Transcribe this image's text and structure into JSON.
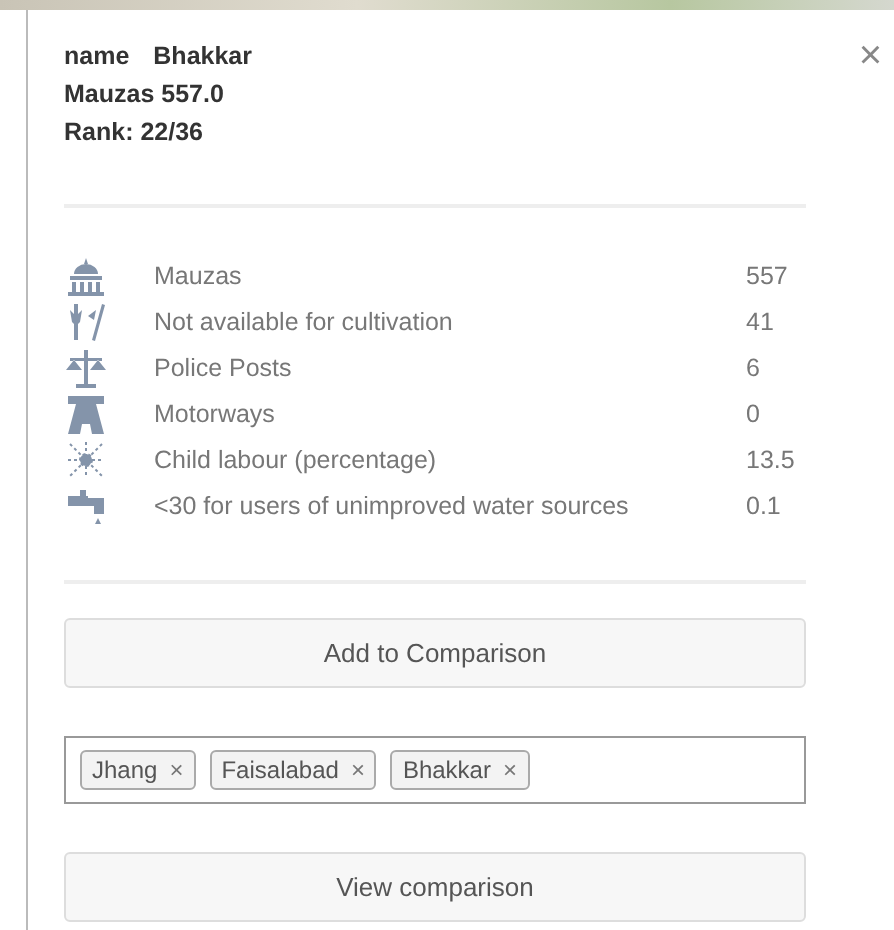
{
  "header": {
    "name_label": "name",
    "name_value": "Bhakkar",
    "subtitle": "Mauzas 557.0",
    "rank": "Rank: 22/36",
    "close": "×"
  },
  "stats": [
    {
      "label": "Mauzas",
      "value": "557"
    },
    {
      "label": "Not available for cultivation",
      "value": "41"
    },
    {
      "label": "Police Posts",
      "value": "6"
    },
    {
      "label": "Motorways",
      "value": "0"
    },
    {
      "label": "Child labour (percentage)",
      "value": "13.5"
    },
    {
      "label": "<30 for users of unimproved water sources",
      "value": "0.1"
    }
  ],
  "add_button": "Add to Comparison",
  "tags": [
    "Jhang",
    "Faisalabad",
    "Bhakkar"
  ],
  "tag_remove": "×",
  "view_button": "View comparison"
}
